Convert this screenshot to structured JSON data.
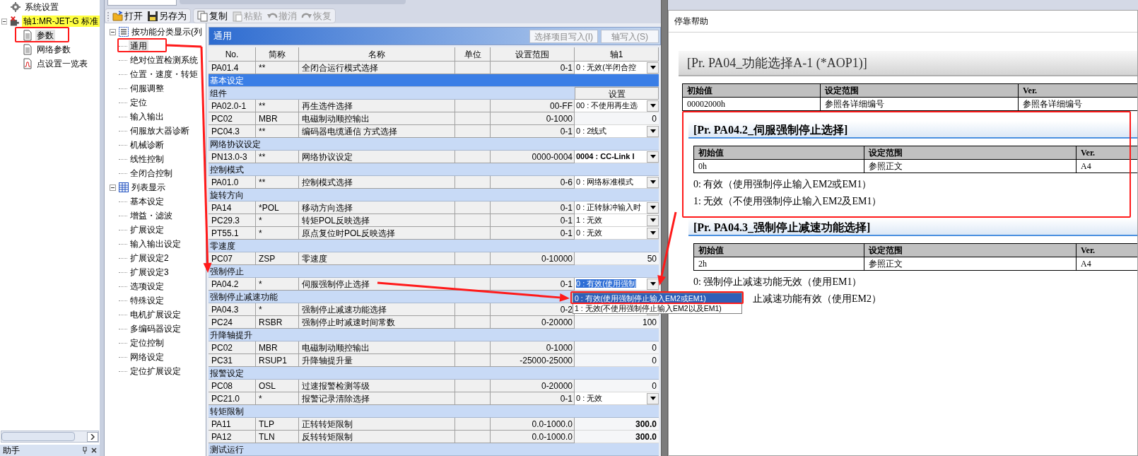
{
  "nav_tree": [
    {
      "label": "系统设置",
      "kind": "settings",
      "selected": false
    },
    {
      "label": "轴1:MR-JET-G 标准",
      "kind": "axis",
      "selected": true,
      "expanded": true,
      "children": [
        {
          "label": "参数",
          "kind": "doc",
          "selected": true
        },
        {
          "label": "网络参数",
          "kind": "doc",
          "selected": false
        },
        {
          "label": "点设置一览表",
          "kind": "chart",
          "selected": false
        }
      ]
    }
  ],
  "bottom_panel": {
    "title": "助手"
  },
  "toolbar": [
    {
      "label": "打开",
      "kind": "open",
      "disabled": false
    },
    {
      "label": "另存为",
      "kind": "save",
      "disabled": false
    },
    {
      "label": "复制",
      "kind": "copy",
      "disabled": false
    },
    {
      "label": "粘贴",
      "kind": "paste",
      "disabled": true
    },
    {
      "label": "撤消",
      "kind": "undo",
      "disabled": true
    },
    {
      "label": "恢复",
      "kind": "redo",
      "disabled": true
    }
  ],
  "category_tree": [
    {
      "label": "按功能分类显示(列",
      "kind": "function",
      "expanded": true,
      "children": [
        {
          "label": "通用",
          "selected": true
        },
        {
          "label": "绝对位置检测系统",
          "selected": false
        },
        {
          "label": "位置・速度・转矩",
          "selected": false
        },
        {
          "label": "伺服调整",
          "selected": false
        },
        {
          "label": "定位",
          "selected": false
        },
        {
          "label": "输入输出",
          "selected": false
        },
        {
          "label": "伺服放大器诊断",
          "selected": false
        },
        {
          "label": "机械诊断",
          "selected": false
        },
        {
          "label": "线性控制",
          "selected": false
        },
        {
          "label": "全闭合控制",
          "selected": false
        }
      ]
    },
    {
      "label": "列表显示",
      "kind": "list",
      "expanded": true,
      "children": [
        {
          "label": "基本设定",
          "selected": false
        },
        {
          "label": "增益・滤波",
          "selected": false
        },
        {
          "label": "扩展设定",
          "selected": false
        },
        {
          "label": "输入输出设定",
          "selected": false
        },
        {
          "label": "扩展设定2",
          "selected": false
        },
        {
          "label": "扩展设定3",
          "selected": false
        },
        {
          "label": "选项设定",
          "selected": false
        },
        {
          "label": "特殊设定",
          "selected": false
        },
        {
          "label": "电机扩展设定",
          "selected": false
        },
        {
          "label": "多编码器设定",
          "selected": false
        },
        {
          "label": "定位控制",
          "selected": false
        },
        {
          "label": "网络设定",
          "selected": false
        },
        {
          "label": "定位扩展设定",
          "selected": false
        }
      ]
    }
  ],
  "parameter_panel": {
    "title": "通用",
    "buttons": [
      "选择项目写入(I)",
      "轴写入(S)"
    ],
    "columns": [
      "No.",
      "简称",
      "名称",
      "单位",
      "设置范围",
      "轴1"
    ],
    "rows": [
      {
        "kind": "param",
        "selected": false,
        "no": "PA01.4",
        "abbr": "**",
        "name": "全闭合运行模式选择",
        "range": "0-1",
        "axis": {
          "kind": "combo",
          "value": "0 : 无效(半闭合控",
          "bold": false,
          "focused": false
        }
      },
      {
        "kind": "group",
        "selected": true,
        "label": "基本设定"
      },
      {
        "kind": "group",
        "selected": false,
        "label": "组件",
        "axis_button": "设置"
      },
      {
        "kind": "param",
        "selected": false,
        "no": "PA02.0-1",
        "abbr": "**",
        "name": "再生选件选择",
        "range": "00-FF",
        "axis": {
          "kind": "combo",
          "value": "00 : 不使用再生选",
          "bold": false,
          "focused": false
        }
      },
      {
        "kind": "param",
        "selected": false,
        "no": "PC02",
        "abbr": "MBR",
        "name": "电磁制动顺控输出",
        "range": "0-1000",
        "axis": {
          "kind": "number",
          "value": "0",
          "bold": false
        }
      },
      {
        "kind": "param",
        "selected": false,
        "no": "PC04.3",
        "abbr": "**",
        "name": "编码器电缆通信 方式选择",
        "range": "0-1",
        "axis": {
          "kind": "combo",
          "value": "0 : 2线式",
          "bold": false,
          "focused": false
        }
      },
      {
        "kind": "group",
        "selected": false,
        "label": "网络协议设定"
      },
      {
        "kind": "param",
        "selected": false,
        "no": "PN13.0-3",
        "abbr": "**",
        "name": "网络协议设定",
        "range": "0000-0004",
        "axis": {
          "kind": "combo",
          "value": "0004 : CC-Link I",
          "bold": true,
          "focused": false
        }
      },
      {
        "kind": "group",
        "selected": false,
        "label": "控制模式"
      },
      {
        "kind": "param",
        "selected": false,
        "no": "PA01.0",
        "abbr": "**",
        "name": "控制模式选择",
        "range": "0-6",
        "axis": {
          "kind": "combo",
          "value": "0 : 网络标准模式",
          "bold": false,
          "focused": false
        }
      },
      {
        "kind": "group",
        "selected": false,
        "label": "旋转方向"
      },
      {
        "kind": "param",
        "selected": false,
        "no": "PA14",
        "abbr": "*POL",
        "name": "移动方向选择",
        "range": "0-1",
        "axis": {
          "kind": "combo",
          "value": "0 : 正转脉冲输入时",
          "bold": false,
          "focused": false
        }
      },
      {
        "kind": "param",
        "selected": false,
        "no": "PC29.3",
        "abbr": "*",
        "name": "转矩POL反映选择",
        "range": "0-1",
        "axis": {
          "kind": "combo",
          "value": "1 : 无效",
          "bold": false,
          "focused": false
        }
      },
      {
        "kind": "param",
        "selected": false,
        "no": "PT55.1",
        "abbr": "*",
        "name": "原点复位时POL反映选择",
        "range": "0-1",
        "axis": {
          "kind": "combo",
          "value": "0 : 无效",
          "bold": false,
          "focused": false
        }
      },
      {
        "kind": "group",
        "selected": false,
        "label": "零速度"
      },
      {
        "kind": "param",
        "selected": false,
        "no": "PC07",
        "abbr": "ZSP",
        "name": "零速度",
        "range": "0-10000",
        "axis": {
          "kind": "number",
          "value": "50",
          "bold": false
        }
      },
      {
        "kind": "group",
        "selected": false,
        "label": "强制停止"
      },
      {
        "kind": "param",
        "selected": false,
        "no": "PA04.2",
        "abbr": "*",
        "name": "伺服强制停止选择",
        "range": "0-1",
        "axis": {
          "kind": "combo",
          "value": "0 : 有效(使用强制",
          "bold": false,
          "focused": true
        }
      },
      {
        "kind": "group",
        "selected": false,
        "label": "强制停止减速功能"
      },
      {
        "kind": "param",
        "selected": false,
        "no": "PA04.3",
        "abbr": "*",
        "name": "强制停止减速功能选择",
        "range": "0-2",
        "axis": {
          "kind": "combo"
        }
      },
      {
        "kind": "param",
        "selected": false,
        "no": "PC24",
        "abbr": "RSBR",
        "name": "强制停止时减速时间常数",
        "range": "0-20000",
        "axis": {
          "kind": "number",
          "value": "100",
          "bold": false
        }
      },
      {
        "kind": "group",
        "selected": false,
        "label": "升降轴提升"
      },
      {
        "kind": "param",
        "selected": false,
        "no": "PC02",
        "abbr": "MBR",
        "name": "电磁制动顺控输出",
        "range": "0-1000",
        "axis": {
          "kind": "number",
          "value": "0",
          "bold": false
        }
      },
      {
        "kind": "param",
        "selected": false,
        "no": "PC31",
        "abbr": "RSUP1",
        "name": "升降轴提升量",
        "range": "-25000-25000",
        "axis": {
          "kind": "number",
          "value": "0",
          "bold": false
        }
      },
      {
        "kind": "group",
        "selected": false,
        "label": "报警设定"
      },
      {
        "kind": "param",
        "selected": false,
        "no": "PC08",
        "abbr": "OSL",
        "name": "过速报警检测等级",
        "range": "0-20000",
        "axis": {
          "kind": "number",
          "value": "0",
          "bold": false
        }
      },
      {
        "kind": "param",
        "selected": false,
        "no": "PC21.0",
        "abbr": "*",
        "name": "报警记录清除选择",
        "range": "0-1",
        "axis": {
          "kind": "combo",
          "value": "0 : 无效",
          "bold": false,
          "focused": false
        }
      },
      {
        "kind": "group",
        "selected": false,
        "label": "转矩限制"
      },
      {
        "kind": "param",
        "selected": false,
        "no": "PA11",
        "abbr": "TLP",
        "name": "正转转矩限制",
        "range": "0.0-1000.0",
        "axis": {
          "kind": "number",
          "value": "300.0",
          "bold": true
        }
      },
      {
        "kind": "param",
        "selected": false,
        "no": "PA12",
        "abbr": "TLN",
        "name": "反转转矩限制",
        "range": "0.0-1000.0",
        "axis": {
          "kind": "number",
          "value": "300.0",
          "bold": true
        }
      },
      {
        "kind": "group",
        "selected": false,
        "label": "测试运行"
      }
    ],
    "dropdown_list": [
      {
        "label": "0 : 有效(使用强制停止输入EM2或EM1)",
        "selected": true
      },
      {
        "label": "1 : 无效(不使用强制停止输入EM2以及EM1)",
        "selected": false
      }
    ]
  },
  "help_window": {
    "title": "停靠帮助",
    "header": "[Pr. PA04_功能选择A-1 (*AOP1)]",
    "table": {
      "columns": [
        "初始值",
        "设定范围",
        "Ver."
      ],
      "row": [
        "00002000h",
        "参照各详细编号",
        "参照各详细编号"
      ]
    },
    "sections": [
      {
        "heading": "[Pr. PA04.2_伺服强制停止选择]",
        "table": {
          "columns": [
            "初始值",
            "设定范围",
            "Ver."
          ],
          "row": [
            "0h",
            "参照正文",
            "A4"
          ]
        },
        "lines": [
          "0: 有效（使用强制停止输入EM2或EM1）",
          "1: 无效（不使用强制停止输入EM2及EM1）"
        ]
      },
      {
        "heading": "[Pr. PA04.3_强制停止减速功能选择]",
        "table": {
          "columns": [
            "初始值",
            "设定范围",
            "Ver."
          ],
          "row": [
            "2h",
            "参照正文",
            "A4"
          ]
        },
        "lines": [
          "0: 强制停止减速功能无效（使用EM1）",
          "止减速功能有效（使用EM2）"
        ]
      }
    ]
  }
}
